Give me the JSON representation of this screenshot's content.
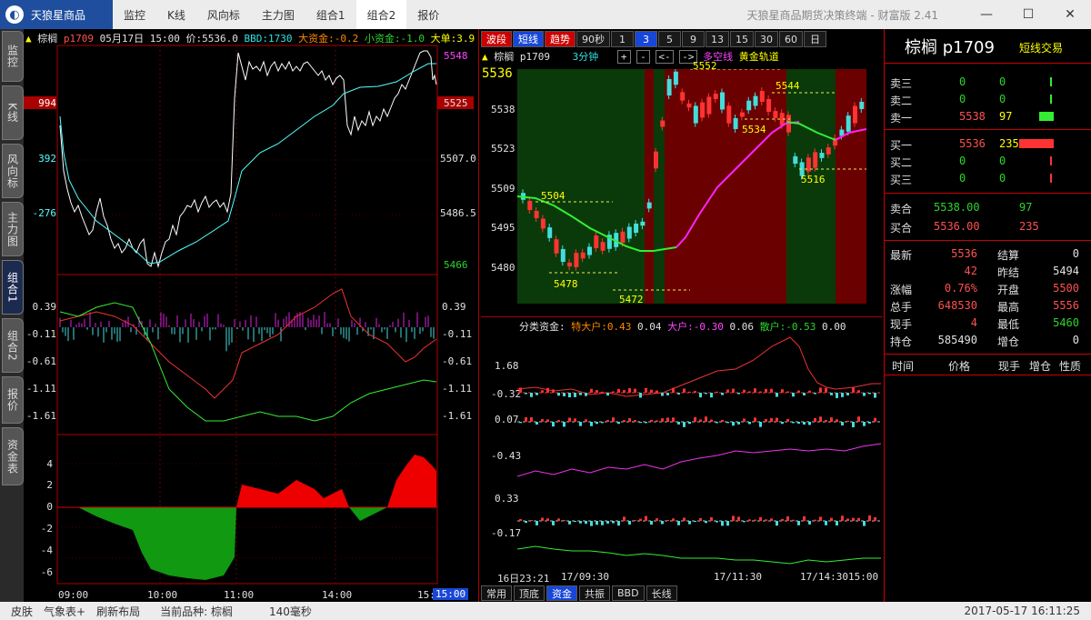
{
  "app": {
    "name": "天狼星商品",
    "window_title": "天狼星商品期货决策终端 - 财富版 2.41"
  },
  "menu": [
    "监控",
    "K线",
    "风向标",
    "主力图",
    "组合1",
    "组合2",
    "报价"
  ],
  "menu_active": "组合2",
  "window_controls": {
    "min": "—",
    "max": "☐",
    "close": "✕"
  },
  "vtabs": [
    "监控",
    "K线",
    "风向标",
    "主力图",
    "组合1",
    "组合2",
    "报价",
    "资金表"
  ],
  "vtab_active": "组合1",
  "left_chart": {
    "header": {
      "symbol": "棕榈",
      "code": "p1709",
      "date": "05月17日",
      "time": "15:00",
      "price_label": "价:5536.0",
      "bbd": "BBD:1730",
      "big_money": "大资金:-0.2",
      "small_money": "小资金:-1.0",
      "big_order": "大单:3.9"
    },
    "price_right": [
      "5548",
      "5525",
      "5507.0",
      "5486.5",
      "5466"
    ],
    "price_left": [
      "994",
      "392",
      "-276"
    ],
    "money_axis": [
      "0.39",
      "-0.11",
      "-0.61",
      "-1.11",
      "-1.61"
    ],
    "bottom_axis": [
      "4",
      "2",
      "0",
      "-2",
      "-4",
      "-6"
    ],
    "time_labels": [
      "09:00",
      "10:00",
      "11:00",
      "14:00",
      "15:",
      "15:00"
    ]
  },
  "period_bar": {
    "modes": [
      "波段",
      "短线",
      "趋势"
    ],
    "periods": [
      "90秒",
      "1",
      "3",
      "5",
      "9",
      "13",
      "15",
      "30",
      "60",
      "日"
    ],
    "active_period": "3"
  },
  "kline": {
    "header": {
      "symbol": "棕榈",
      "code": "p1709",
      "period": "3分钟",
      "nav": [
        "+",
        "-",
        "<-",
        "->"
      ],
      "line1": "多空线",
      "line2": "黄金轨道"
    },
    "price_axis": [
      "5536",
      "5538",
      "5523",
      "5509",
      "5495",
      "5480"
    ],
    "annotations": [
      "5552",
      "5544",
      "5534",
      "5504",
      "5516",
      "5478",
      "5472"
    ]
  },
  "capital": {
    "header": {
      "label": "分类资金:",
      "special_big": "特大户:0.43",
      "v1": "0.04",
      "big": "大户:-0.30",
      "v2": "0.06",
      "retail": "散户:-0.53",
      "v3": "0.00"
    },
    "axis": [
      "1.68",
      "-0.32",
      "0.07",
      "-0.43",
      "0.33",
      "-0.17"
    ],
    "time_labels": [
      "16日23:21",
      "17/09:30",
      "17/11:30",
      "17/14:30",
      "15:00"
    ]
  },
  "bottom_tabs": [
    "常用",
    "顶底",
    "资金",
    "共振",
    "BBD",
    "长线"
  ],
  "bottom_tab_active": "资金",
  "quote": {
    "title": "棕榈 p1709",
    "mode": "短线交易",
    "asks": [
      {
        "label": "卖三",
        "price": "0",
        "vol": "0"
      },
      {
        "label": "卖二",
        "price": "0",
        "vol": "0"
      },
      {
        "label": "卖一",
        "price": "5538",
        "vol": "97"
      }
    ],
    "bids": [
      {
        "label": "买一",
        "price": "5536",
        "vol": "235"
      },
      {
        "label": "买二",
        "price": "0",
        "vol": "0"
      },
      {
        "label": "买三",
        "price": "0",
        "vol": "0"
      }
    ],
    "sell_total": {
      "label": "卖合",
      "price": "5538.00",
      "vol": "97"
    },
    "buy_total": {
      "label": "买合",
      "price": "5536.00",
      "vol": "235"
    },
    "stats": [
      {
        "l1": "最新",
        "v1": "5536",
        "l2": "结算",
        "v2": "0"
      },
      {
        "l1": "",
        "v1": "42",
        "l2": "昨结",
        "v2": "5494"
      },
      {
        "l1": "涨幅",
        "v1": "0.76%",
        "l2": "开盘",
        "v2": "5500"
      },
      {
        "l1": "总手",
        "v1": "648530",
        "l2": "最高",
        "v2": "5556"
      },
      {
        "l1": "现手",
        "v1": "4",
        "l2": "最低",
        "v2": "5460"
      },
      {
        "l1": "持仓",
        "v1": "585490",
        "l2": "增仓",
        "v2": "0"
      }
    ],
    "trade_headers": [
      "时间",
      "价格",
      "现手",
      "增仓",
      "性质"
    ]
  },
  "status": {
    "items": [
      "皮肤",
      "气象表+",
      "刷新布局",
      "当前品种: 棕榈",
      "140毫秒"
    ],
    "time": "2017-05-17  16:11:25"
  }
}
